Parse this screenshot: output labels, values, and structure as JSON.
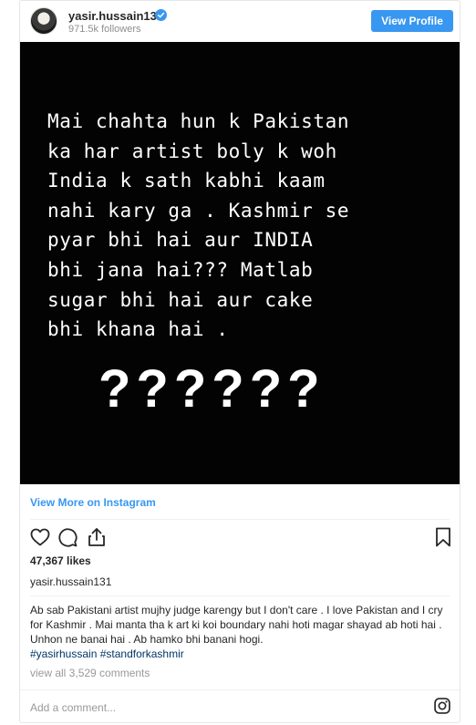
{
  "header": {
    "username": "yasir.hussain131",
    "followers": "971.5k followers",
    "view_profile_label": "View Profile",
    "verified_color": "#3897f0"
  },
  "post": {
    "image_text_lines": [
      "Mai chahta hun k Pakistan",
      "ka har artist boly k woh",
      "India k sath kabhi kaam",
      "nahi kary ga . Kashmir se",
      "pyar bhi hai aur INDIA",
      "bhi jana hai??? Matlab",
      "sugar bhi hai aur cake",
      "bhi khana hai ."
    ],
    "image_text": "Mai chahta hun k Pakistan\nka har artist boly k woh\nIndia k sath kabhi kaam\nnahi kary ga . Kashmir se\npyar bhi hai aur INDIA\nbhi jana hai??? Matlab\nsugar bhi hai aur cake\nbhi khana hai .",
    "question_marks": "??????",
    "background_color": "#030303"
  },
  "view_more_label": "View More on Instagram",
  "actions": {
    "icons": [
      "heart-icon",
      "comment-icon",
      "share-icon",
      "bookmark-icon"
    ]
  },
  "likes": "47,367 likes",
  "caption": {
    "username": "yasir.hussain131",
    "text": "Ab sab Pakistani artist mujhy judge karengy but I don't care . I love Pakistan and I cry for Kashmir . Mai manta tha k art ki koi boundary nahi hoti magar shayad ab hoti hai . Unhon ne banai hai . Ab hamko bhi banani hogi.",
    "hashtags": [
      "#yasirhussain",
      "#standforkashmir"
    ]
  },
  "comments_link": "view all 3,529 comments",
  "comment_input": {
    "placeholder": "Add a comment..."
  },
  "colors": {
    "accent": "#3897f0",
    "hashtag": "#003569",
    "muted": "#999999"
  }
}
